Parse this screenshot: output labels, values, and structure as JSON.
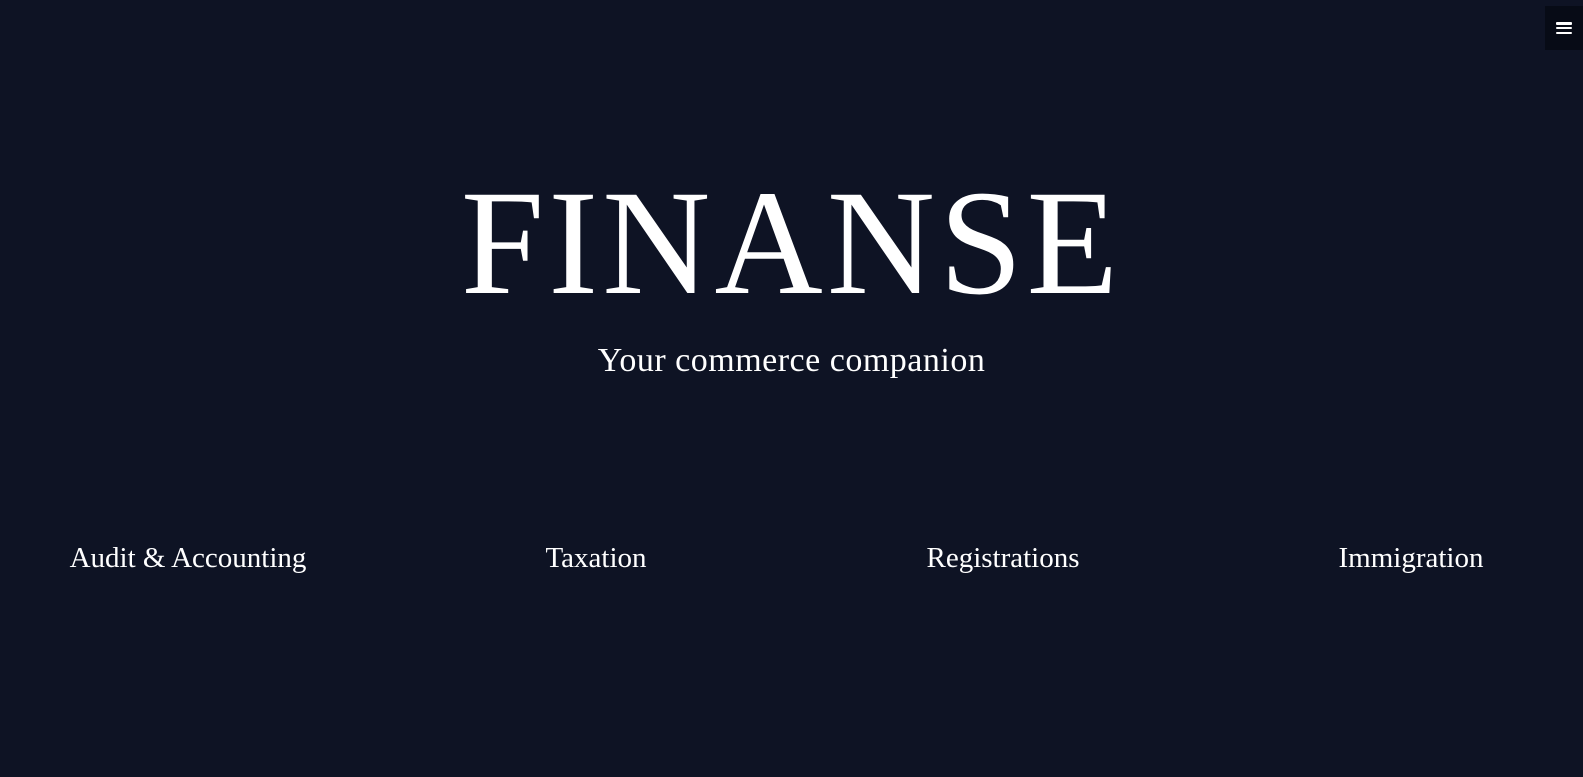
{
  "header": {
    "menu_icon": "hamburger-menu-icon"
  },
  "hero": {
    "title": "FINANSE",
    "subtitle": "Your commerce companion"
  },
  "services": [
    {
      "label": "Audit & Accounting"
    },
    {
      "label": "Taxation"
    },
    {
      "label": "Registrations"
    },
    {
      "label": "Immigration"
    }
  ],
  "colors": {
    "background": "#0e1324",
    "menu_background": "#070b16",
    "text": "#ffffff"
  }
}
